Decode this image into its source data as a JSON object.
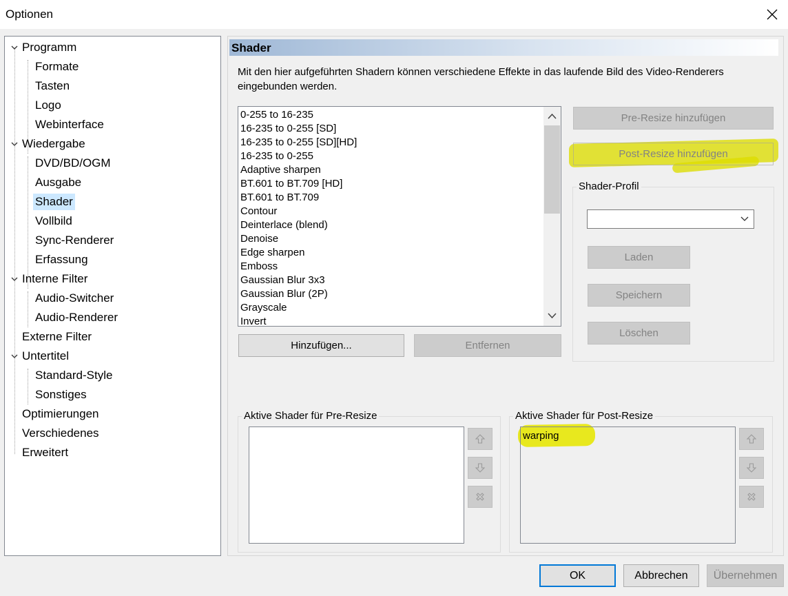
{
  "window": {
    "title": "Optionen"
  },
  "tree": [
    {
      "label": "Programm",
      "level": 0,
      "expanded": true
    },
    {
      "label": "Formate",
      "level": 1
    },
    {
      "label": "Tasten",
      "level": 1
    },
    {
      "label": "Logo",
      "level": 1
    },
    {
      "label": "Webinterface",
      "level": 1
    },
    {
      "label": "Wiedergabe",
      "level": 0,
      "expanded": true
    },
    {
      "label": "DVD/BD/OGM",
      "level": 1
    },
    {
      "label": "Ausgabe",
      "level": 1
    },
    {
      "label": "Shader",
      "level": 1,
      "selected": true
    },
    {
      "label": "Vollbild",
      "level": 1
    },
    {
      "label": "Sync-Renderer",
      "level": 1
    },
    {
      "label": "Erfassung",
      "level": 1
    },
    {
      "label": "Interne Filter",
      "level": 0,
      "expanded": true
    },
    {
      "label": "Audio-Switcher",
      "level": 1
    },
    {
      "label": "Audio-Renderer",
      "level": 1
    },
    {
      "label": "Externe Filter",
      "level": 0
    },
    {
      "label": "Untertitel",
      "level": 0,
      "expanded": true
    },
    {
      "label": "Standard-Style",
      "level": 1
    },
    {
      "label": "Sonstiges",
      "level": 1
    },
    {
      "label": "Optimierungen",
      "level": 0
    },
    {
      "label": "Verschiedenes",
      "level": 0
    },
    {
      "label": "Erweitert",
      "level": 0
    }
  ],
  "page": {
    "header": "Shader",
    "description_line1": "Mit den hier aufgeführten Shadern können verschiedene Effekte in das laufende Bild des Video-Renderers",
    "description_line2": "eingebunden werden."
  },
  "shader_list": [
    "0-255 to 16-235",
    "16-235 to 0-255 [SD]",
    "16-235 to 0-255 [SD][HD]",
    "16-235 to 0-255",
    "Adaptive sharpen",
    "BT.601 to BT.709 [HD]",
    "BT.601 to BT.709",
    "Contour",
    "Deinterlace (blend)",
    "Denoise",
    "Edge sharpen",
    "Emboss",
    "Gaussian Blur 3x3",
    "Gaussian Blur (2P)",
    "Grayscale",
    "Invert"
  ],
  "buttons": {
    "add": "Hinzufügen...",
    "remove": "Entfernen",
    "pre_resize_add": "Pre-Resize hinzufügen",
    "post_resize_add": "Post-Resize hinzufügen",
    "load": "Laden",
    "save": "Speichern",
    "delete": "Löschen",
    "ok": "OK",
    "cancel": "Abbrechen",
    "apply": "Übernehmen"
  },
  "profile": {
    "label": "Shader-Profil",
    "value": ""
  },
  "pre_resize": {
    "label": "Aktive Shader für Pre-Resize",
    "items": []
  },
  "post_resize": {
    "label": "Aktive Shader für Post-Resize",
    "items": [
      "warping"
    ]
  },
  "colors": {
    "highlight": "#dcdc00",
    "selection": "#cce8ff",
    "accent": "#0078d7"
  }
}
